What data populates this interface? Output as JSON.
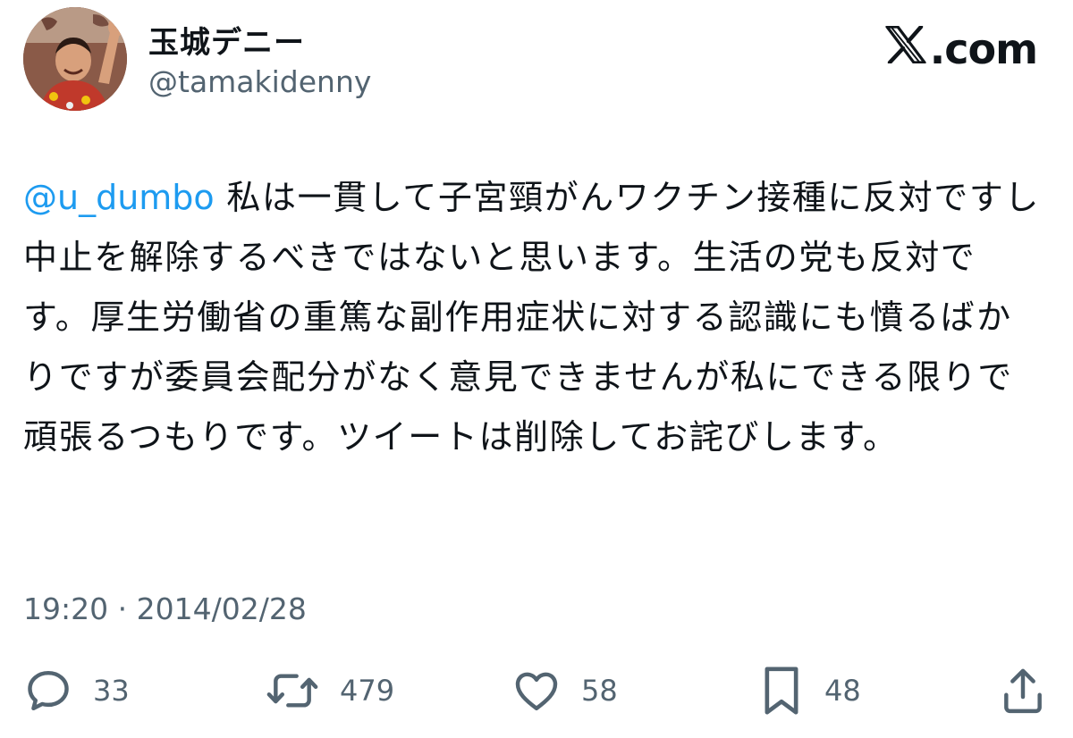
{
  "author": {
    "display_name": "玉城デニー",
    "handle": "@tamakidenny"
  },
  "brand": {
    "logo_text": ".com",
    "logo_mark": "𝕏"
  },
  "tweet": {
    "mention": "@u_dumbo",
    "text": " 私は一貫して子宮頸がんワクチン接種に反対ですし中止を解除するべきではないと思います。生活の党も反対です。厚生労働省の重篤な副作用症状に対する認識にも憤るばかりですが委員会配分がなく意見できませんが私にできる限りで頑張るつもりです。ツイートは削除してお詫びします。",
    "time": "19:20",
    "separator": "·",
    "date": "2014/02/28"
  },
  "actions": {
    "reply": {
      "icon": "reply-icon",
      "count": "33"
    },
    "retweet": {
      "icon": "retweet-icon",
      "count": "479"
    },
    "like": {
      "icon": "heart-icon",
      "count": "58"
    },
    "bookmark": {
      "icon": "bookmark-icon",
      "count": "48"
    },
    "share": {
      "icon": "share-icon"
    }
  },
  "colors": {
    "link": "#1d9bf0",
    "secondary": "#536471",
    "text": "#0f1419"
  }
}
